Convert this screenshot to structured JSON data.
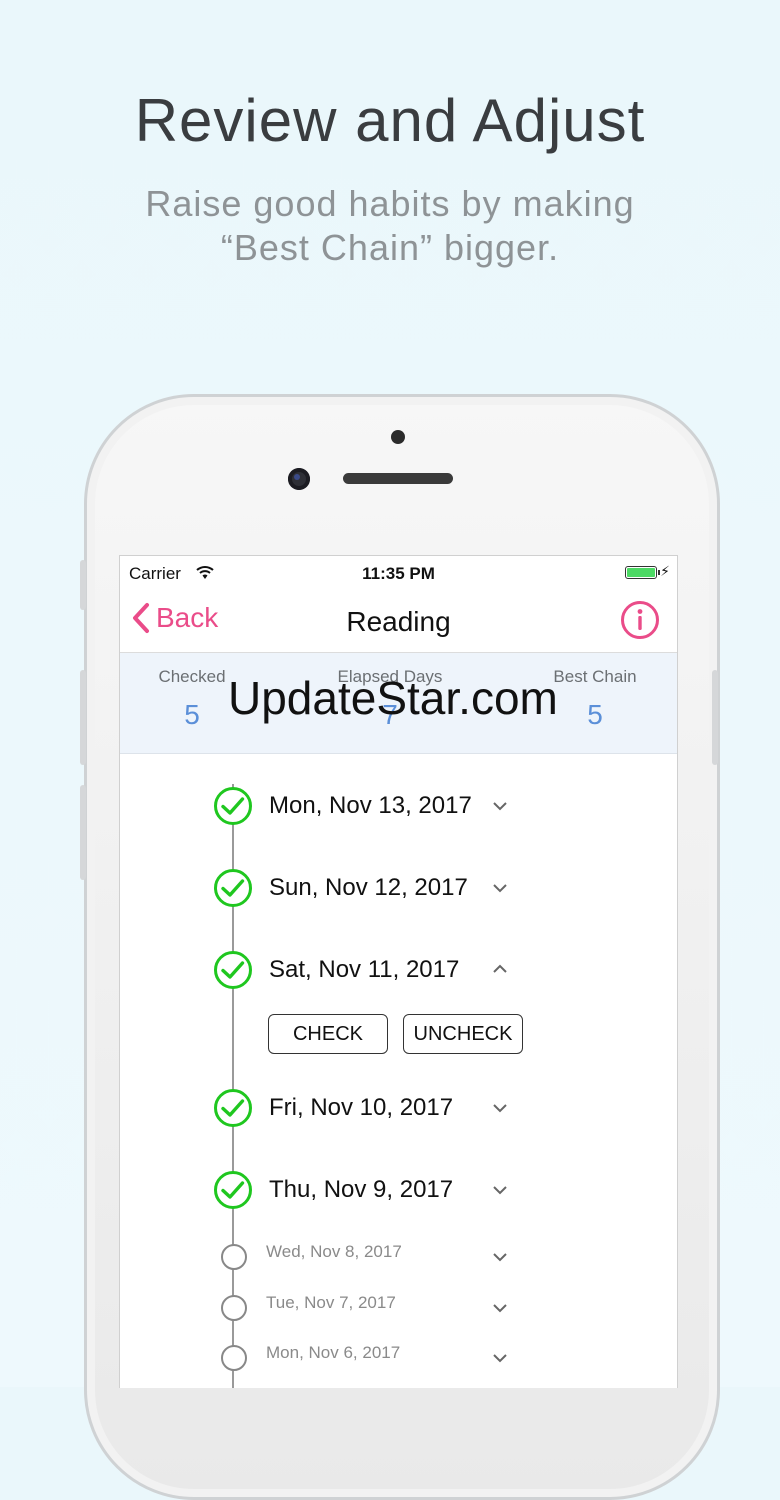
{
  "hero": {
    "title": "Review and Adjust",
    "subtitle_line1": "Raise good habits by making",
    "subtitle_line2": "“Best Chain” bigger."
  },
  "status_bar": {
    "carrier": "Carrier",
    "time": "11:35 PM",
    "battery_color": "#4cd964"
  },
  "nav": {
    "back_label": "Back",
    "title": "Reading",
    "accent": "#ea4c89"
  },
  "stats": [
    {
      "label": "Checked",
      "value": "5"
    },
    {
      "label": "Elapsed Days",
      "value": "7"
    },
    {
      "label": "Best Chain",
      "value": "5"
    }
  ],
  "watermark": "UpdateStar.com",
  "entries": [
    {
      "date": "Mon, Nov 13, 2017",
      "checked": true,
      "expanded": false
    },
    {
      "date": "Sun, Nov 12, 2017",
      "checked": true,
      "expanded": false
    },
    {
      "date": "Sat, Nov 11, 2017",
      "checked": true,
      "expanded": true
    },
    {
      "date": "Fri, Nov 10, 2017",
      "checked": true,
      "expanded": false
    },
    {
      "date": "Thu, Nov 9, 2017",
      "checked": true,
      "expanded": false
    },
    {
      "date": "Wed, Nov 8, 2017",
      "checked": false,
      "expanded": false
    },
    {
      "date": "Tue, Nov 7, 2017",
      "checked": false,
      "expanded": false
    },
    {
      "date": "Mon, Nov 6, 2017",
      "checked": false,
      "expanded": false
    }
  ],
  "actions": {
    "check_label": "CHECK",
    "uncheck_label": "UNCHECK"
  },
  "colors": {
    "check_green": "#1fc71f",
    "stat_blue": "#5b8fd8"
  }
}
